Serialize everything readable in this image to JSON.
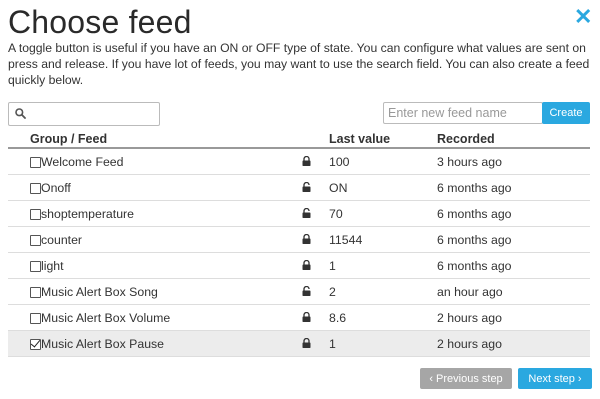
{
  "dialog": {
    "title": "Choose feed",
    "description": "A toggle button is useful if you have an ON or OFF type of state. You can configure what values are sent on press and release. If you have lot of feeds, you may want to use the search field. You can also create a feed quickly below.",
    "close_icon": "close-icon",
    "accent_color": "#2aa8e0"
  },
  "search": {
    "placeholder": "",
    "value": "",
    "icon": "search-icon"
  },
  "new_feed": {
    "placeholder": "Enter new feed name",
    "create_label": "Create"
  },
  "table": {
    "headers": {
      "name": "Group / Feed",
      "value": "Last value",
      "recorded": "Recorded"
    },
    "rows": [
      {
        "name": "Welcome Feed",
        "locked": true,
        "value": "100",
        "recorded": "3 hours ago",
        "checked": false
      },
      {
        "name": "Onoff",
        "locked": false,
        "value": "ON",
        "recorded": "6 months ago",
        "checked": false
      },
      {
        "name": "shoptemperature",
        "locked": false,
        "value": "70",
        "recorded": "6 months ago",
        "checked": false
      },
      {
        "name": "counter",
        "locked": true,
        "value": "11544",
        "recorded": "6 months ago",
        "checked": false
      },
      {
        "name": "light",
        "locked": true,
        "value": "1",
        "recorded": "6 months ago",
        "checked": false
      },
      {
        "name": "Music Alert Box Song",
        "locked": false,
        "value": "2",
        "recorded": "an hour ago",
        "checked": false
      },
      {
        "name": "Music Alert Box Volume",
        "locked": true,
        "value": "8.6",
        "recorded": "2 hours ago",
        "checked": false
      },
      {
        "name": "Music Alert Box Pause",
        "locked": true,
        "value": "1",
        "recorded": "2 hours ago",
        "checked": true
      }
    ]
  },
  "footer": {
    "previous_label": "‹ Previous step",
    "next_label": "Next step ›"
  }
}
